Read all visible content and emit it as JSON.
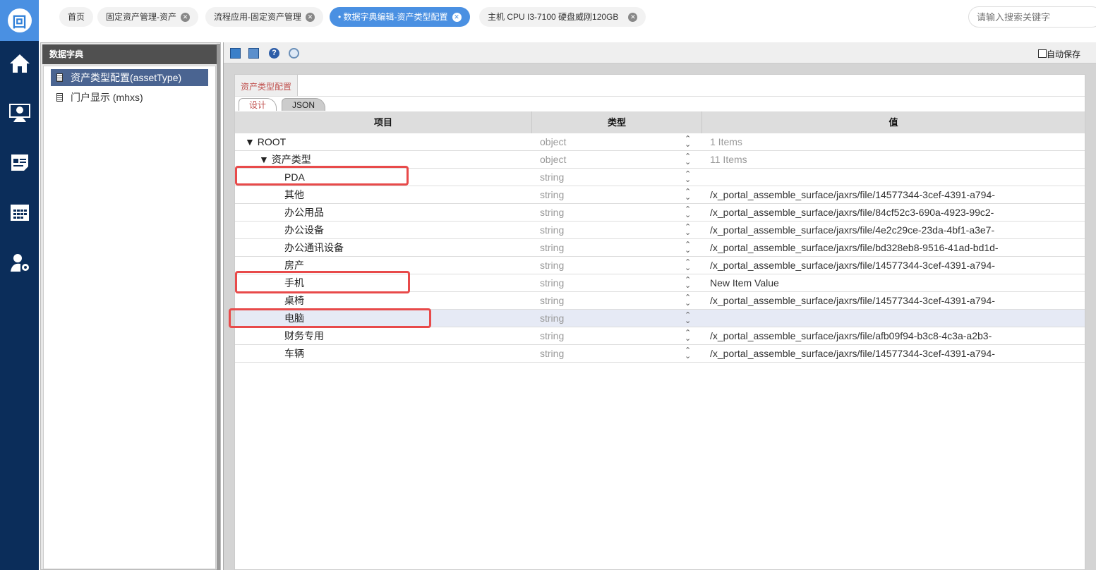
{
  "nav": {
    "logo": "回",
    "icons": [
      "home-icon",
      "monitor-user-icon",
      "news-icon",
      "calendar-icon",
      "user-settings-icon"
    ]
  },
  "tabs": [
    {
      "label": "首页",
      "closable": false
    },
    {
      "label": "固定资产管理-资产",
      "closable": true
    },
    {
      "label": "流程应用-固定资产管理",
      "closable": true
    },
    {
      "label": "• 数据字典编辑-资产类型配置",
      "closable": true,
      "active": true
    },
    {
      "label": "主机 CPU I3-7100 硬盘威刚120GB",
      "closable": true
    }
  ],
  "search": {
    "placeholder": "请输入搜索关键字"
  },
  "left": {
    "title": "数据字典",
    "items": [
      {
        "label": "资产类型配置(assetType)",
        "selected": true
      },
      {
        "label": "门户显示 (mhxs)"
      }
    ]
  },
  "toolbar": {
    "autosave": "自动保存"
  },
  "content": {
    "tab": "资产类型配置",
    "subtabs": [
      "设计",
      "JSON"
    ]
  },
  "grid": {
    "headers": [
      "项目",
      "类型",
      "值"
    ],
    "rows": [
      {
        "key": "▼ ROOT",
        "type": "object",
        "value": "1 Items",
        "level": 0
      },
      {
        "key": "▼ 资产类型",
        "type": "object",
        "value": "11 Items",
        "level": 1
      },
      {
        "key": "PDA",
        "type": "string",
        "value": "",
        "level": 2
      },
      {
        "key": "其他",
        "type": "string",
        "value": "/x_portal_assemble_surface/jaxrs/file/14577344-3cef-4391-a794-",
        "level": 2
      },
      {
        "key": "办公用品",
        "type": "string",
        "value": "/x_portal_assemble_surface/jaxrs/file/84cf52c3-690a-4923-99c2-",
        "level": 2
      },
      {
        "key": "办公设备",
        "type": "string",
        "value": "/x_portal_assemble_surface/jaxrs/file/4e2c29ce-23da-4bf1-a3e7-",
        "level": 2
      },
      {
        "key": "办公通讯设备",
        "type": "string",
        "value": "/x_portal_assemble_surface/jaxrs/file/bd328eb8-9516-41ad-bd1d-",
        "level": 2
      },
      {
        "key": "房产",
        "type": "string",
        "value": "/x_portal_assemble_surface/jaxrs/file/14577344-3cef-4391-a794-",
        "level": 2
      },
      {
        "key": "手机",
        "type": "string",
        "value": "New Item Value",
        "level": 2
      },
      {
        "key": "桌椅",
        "type": "string",
        "value": "/x_portal_assemble_surface/jaxrs/file/14577344-3cef-4391-a794-",
        "level": 2
      },
      {
        "key": "电脑",
        "type": "string",
        "value": "",
        "level": 2,
        "highlight": true
      },
      {
        "key": "财务专用",
        "type": "string",
        "value": "/x_portal_assemble_surface/jaxrs/file/afb09f94-b3c8-4c3a-a2b3-",
        "level": 2
      },
      {
        "key": "车辆",
        "type": "string",
        "value": "/x_portal_assemble_surface/jaxrs/file/14577344-3cef-4391-a794-",
        "level": 2
      }
    ]
  },
  "colors": {
    "nav": "#0b2d5a",
    "accent": "#4a90e2",
    "annotation": "#e84a4a"
  }
}
